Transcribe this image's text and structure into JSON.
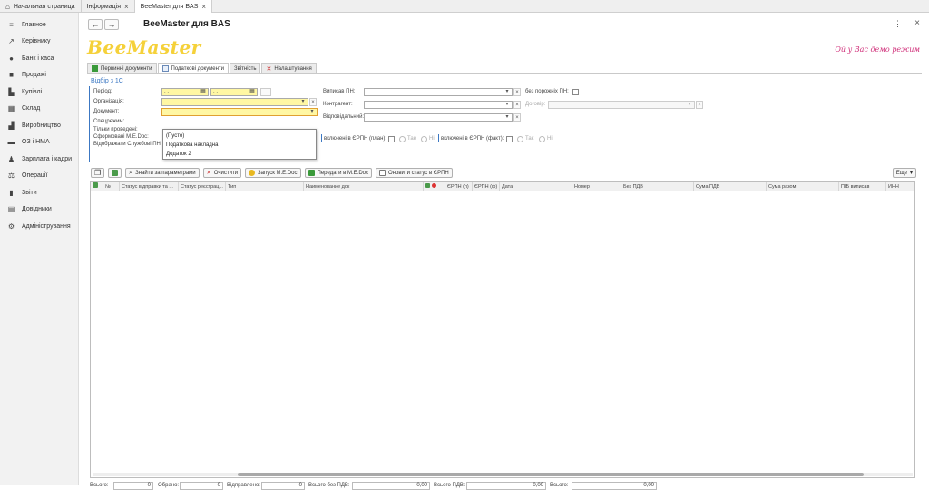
{
  "window_tabs": [
    {
      "label": "Начальная страница",
      "closable": false
    },
    {
      "label": "Інформація",
      "closable": true
    },
    {
      "label": "BeeMaster для BAS",
      "closable": true
    }
  ],
  "sidebar": {
    "items": [
      {
        "label": "Главное",
        "icon": "menu-icon"
      },
      {
        "label": "Керівнику",
        "icon": "chart-line-icon"
      },
      {
        "label": "Банк і каса",
        "icon": "coins-icon"
      },
      {
        "label": "Продажі",
        "icon": "bag-icon"
      },
      {
        "label": "Купівлі",
        "icon": "cart-icon"
      },
      {
        "label": "Склад",
        "icon": "warehouse-icon"
      },
      {
        "label": "Виробництво",
        "icon": "factory-icon"
      },
      {
        "label": "ОЗ і НМА",
        "icon": "truck-icon"
      },
      {
        "label": "Зарплата і кадри",
        "icon": "person-icon"
      },
      {
        "label": "Операції",
        "icon": "operations-icon"
      },
      {
        "label": "Звіти",
        "icon": "bar-chart-icon"
      },
      {
        "label": "Довідники",
        "icon": "book-icon"
      },
      {
        "label": "Адміністрування",
        "icon": "gear-icon"
      }
    ]
  },
  "header": {
    "back": "←",
    "forward": "→",
    "title": "BeeMaster для BAS",
    "menu": "⋮",
    "close": "×"
  },
  "logo_text": "BeeMaster",
  "demo_text": "Ой у Вас демо режим",
  "form_tabs": [
    {
      "label": "Первинні документи",
      "active": false
    },
    {
      "label": "Податкові документи",
      "active": true
    },
    {
      "label": "Звітність",
      "active": false
    },
    {
      "label": "Налаштування",
      "active": false
    }
  ],
  "filter": {
    "group_title": "Відбір з 1С",
    "period_label": "Період:",
    "period_from": " .  .  ",
    "period_to": " .  .  ",
    "period_btn": "...",
    "org_label": "Організація:",
    "doc_label": "Документ:",
    "spec_label": "Спецрежим:",
    "posted_label": "Тільки проведені:",
    "formed_label": "Сформовані M.E.Doc:",
    "show_service_label": "Відображати Службові ПН:",
    "issuer_label": "Виписав ПН:",
    "empty_pn_label": "без порожніх ПН:",
    "counterparty_label": "Контрагент:",
    "contract_label": "Договір:",
    "responsible_label": "Відповідальний:",
    "erpn_plan_label": "включені в ЄРПН (план):",
    "erpn_fact_label": "включені в ЄРПН (факт):",
    "yes_label": "Так",
    "no_label": "Ні"
  },
  "document_dropdown": {
    "options": [
      "(Пусто)",
      "Податкова накладна",
      "Додаток 2"
    ]
  },
  "toolbar": {
    "find_label": "Знайти за параметрами",
    "clear_label": "Очистити",
    "launch_label": "Запуск M.E.Doc",
    "send_label": "Передати в M.E.Doc",
    "update_label": "Оновити статус в ЄРПН",
    "more_label": "Еще"
  },
  "table": {
    "columns": [
      "№",
      "Статус відправки та ...",
      "Статус реєстрац...",
      "Тип",
      "Наименование док",
      "ЄРПН (п)",
      "ЄРПН (ф)",
      "Дата",
      "Номер",
      "Без ПДВ",
      "Сума ПДВ",
      "Сума разом",
      "ПІБ виписав",
      "ИНН"
    ],
    "rows": []
  },
  "footer": {
    "total_label": "Всього:",
    "total_value": "0",
    "selected_label": "Обрано:",
    "selected_value": "0",
    "sent_label": "Відправлено:",
    "sent_value": "0",
    "total_no_vat_label": "Всього без ПДВ:",
    "total_no_vat_value": "0,00",
    "total_vat_label": "Всього ПДВ:",
    "total_vat_value": "0,00",
    "grand_total_label": "Всього:",
    "grand_total_value": "0,00"
  },
  "colors": {
    "accent": "#3c78c3",
    "logo": "#f5d13a",
    "demo": "#d0307a",
    "required_field": "#fff7a3"
  }
}
